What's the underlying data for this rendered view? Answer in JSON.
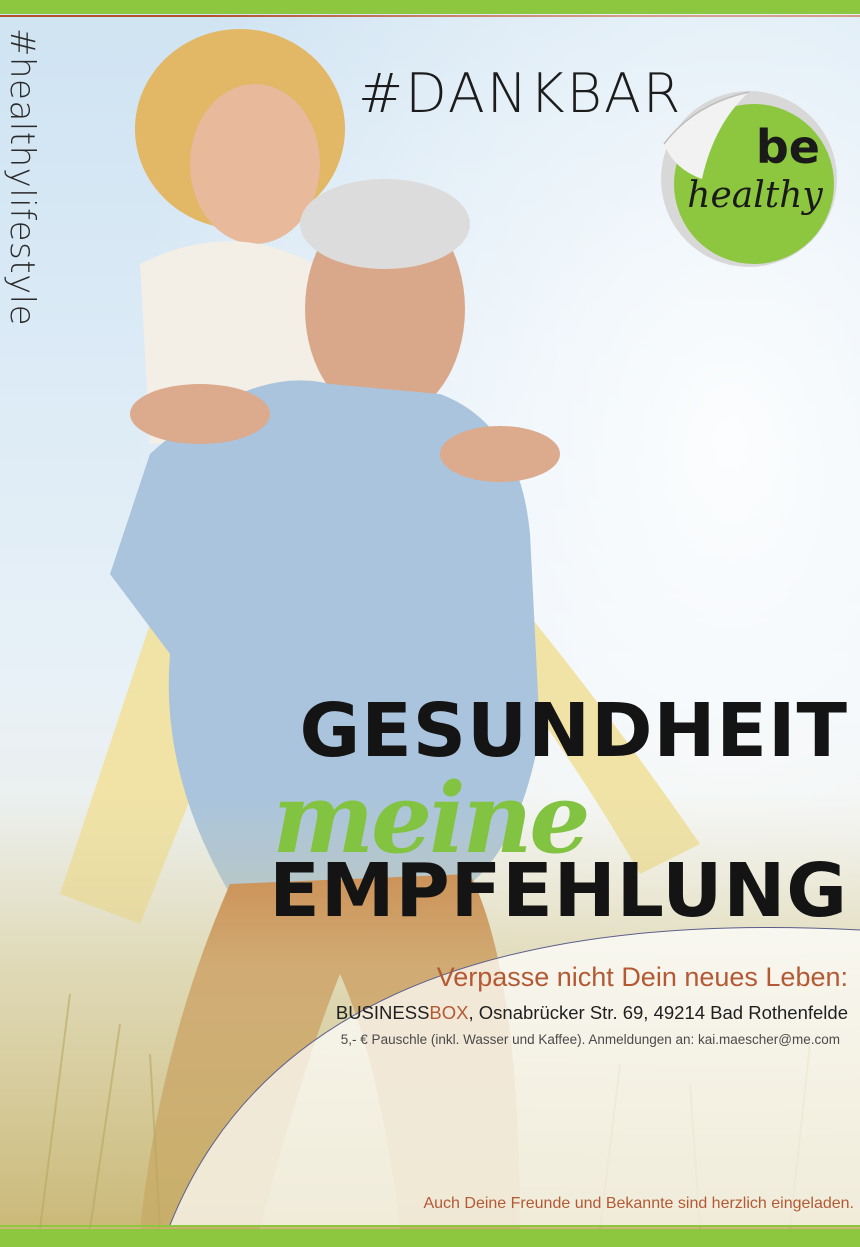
{
  "side_tag": "#healthylifestyle",
  "hashtag_title": "#DANKBAR",
  "badge": {
    "line1": "be",
    "line2": "healthy",
    "color": "#8dc63f"
  },
  "headline": {
    "line1": "GESUNDHEIT",
    "script": "meine",
    "line2": "EMPFEHLUNG",
    "script_color": "#82c341"
  },
  "event": {
    "subhead": "Verpasse nicht Dein neues Leben:",
    "venue_part1": "BUSINESS",
    "venue_part2": "BOX",
    "address": ", Osnabrücker Str. 69, 49214 Bad Rothenfelde",
    "fine_print": "5,- € Pauschle (inkl. Wasser und Kaffee). Anmeldungen an: kai.maescher@me.com",
    "footer": "Auch Deine Freunde und Bekannte sind herzlich eingeladen."
  },
  "colors": {
    "accent_green": "#8dc63f",
    "accent_rust": "#b35a35",
    "text_dark": "#141414"
  },
  "photo_alt": "couple-piggyback-photo"
}
